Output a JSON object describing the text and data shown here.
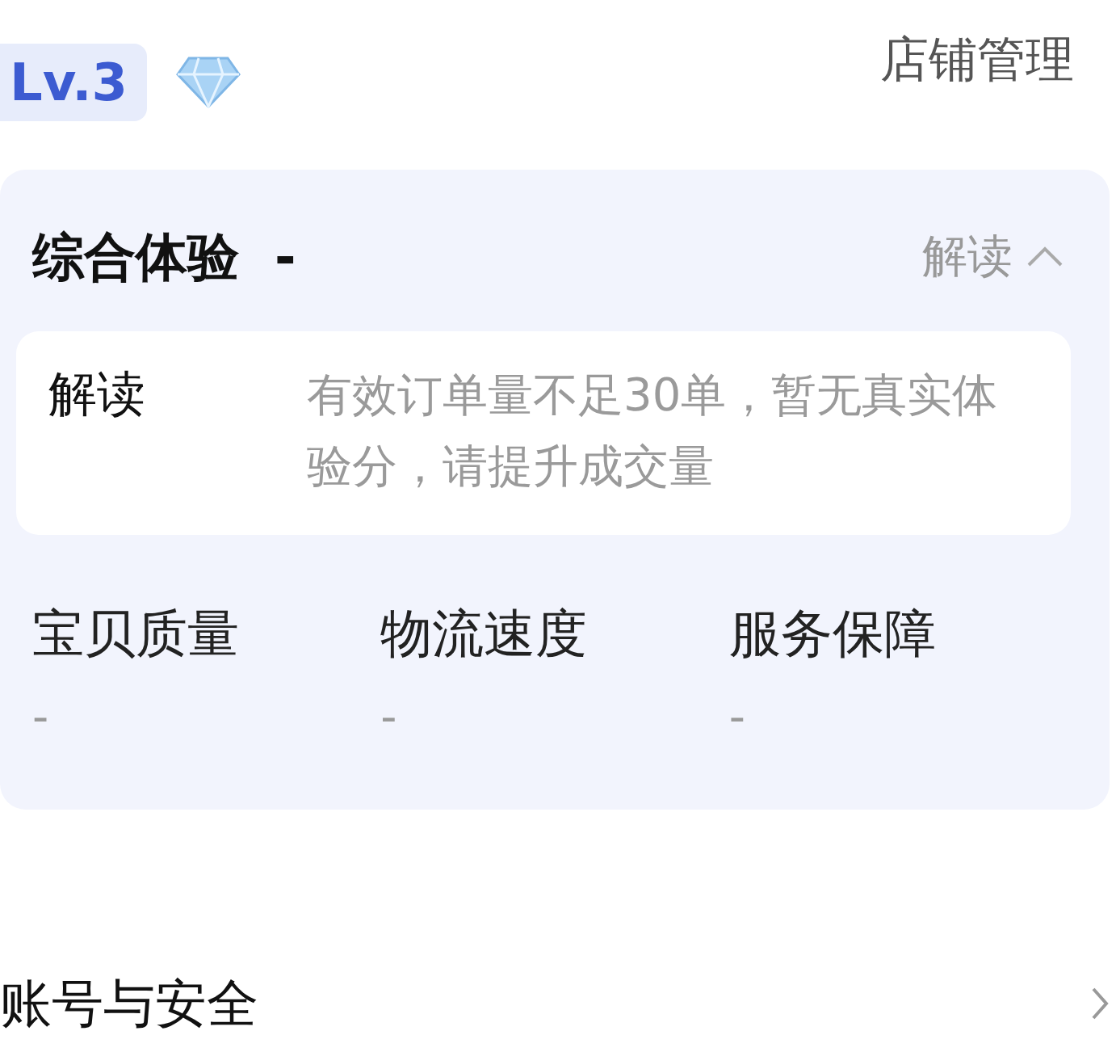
{
  "level_badge": "Lv.3",
  "header_link": "店铺管理",
  "experience": {
    "title": "综合体验",
    "score": "-",
    "toggle": "解读",
    "expanded": true,
    "interpretation": {
      "label": "解读",
      "text": "有效订单量不足30单，暂无真实体验分，请提升成交量"
    },
    "metrics": [
      {
        "label": "宝贝质量",
        "value": "-"
      },
      {
        "label": "物流速度",
        "value": "-"
      },
      {
        "label": "服务保障",
        "value": "-"
      }
    ]
  },
  "next_section": "账号与安全"
}
